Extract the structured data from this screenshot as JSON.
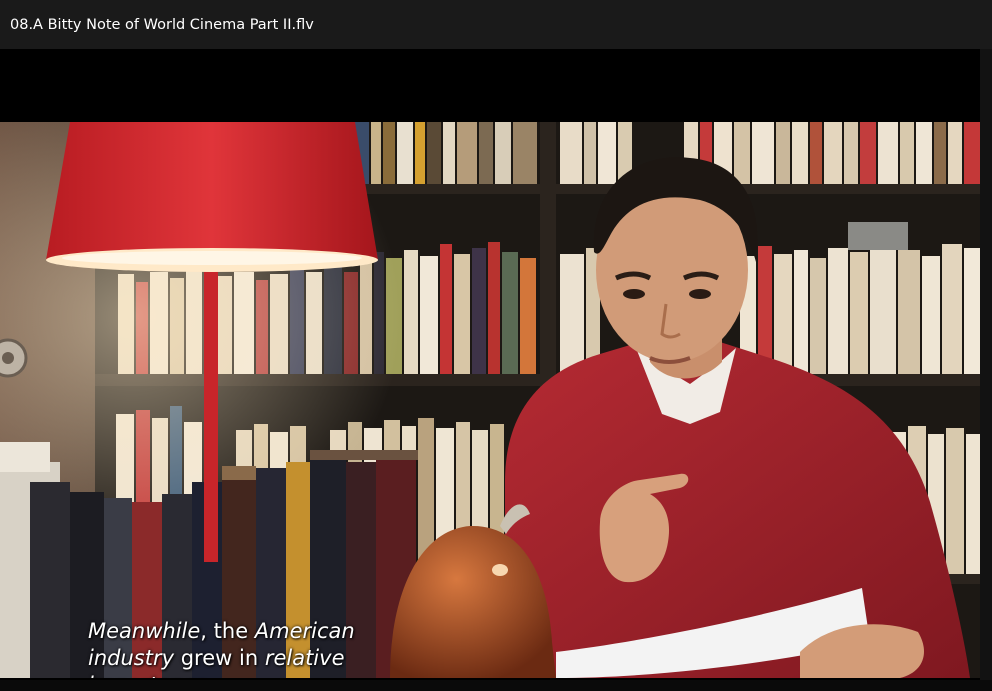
{
  "window": {
    "title": "08.A Bitty Note of World Cinema Part II.flv"
  },
  "video": {
    "subtitle": {
      "line1": [
        {
          "text": "Meanwhile",
          "italic": true
        },
        {
          "text": ", the ",
          "italic": false
        },
        {
          "text": "American",
          "italic": true
        }
      ],
      "line2": [
        {
          "text": "industry",
          "italic": true
        },
        {
          "text": " grew in ",
          "italic": false
        },
        {
          "text": "relative",
          "italic": true
        }
      ],
      "line3": [
        {
          "text": "importance",
          "italic": true
        },
        {
          "text": ".",
          "italic": false
        }
      ]
    }
  },
  "colors": {
    "title_bar": "#1a1a1a",
    "letterbox": "#000000",
    "lamp": "#d7262a",
    "sweater": "#a51f28"
  }
}
